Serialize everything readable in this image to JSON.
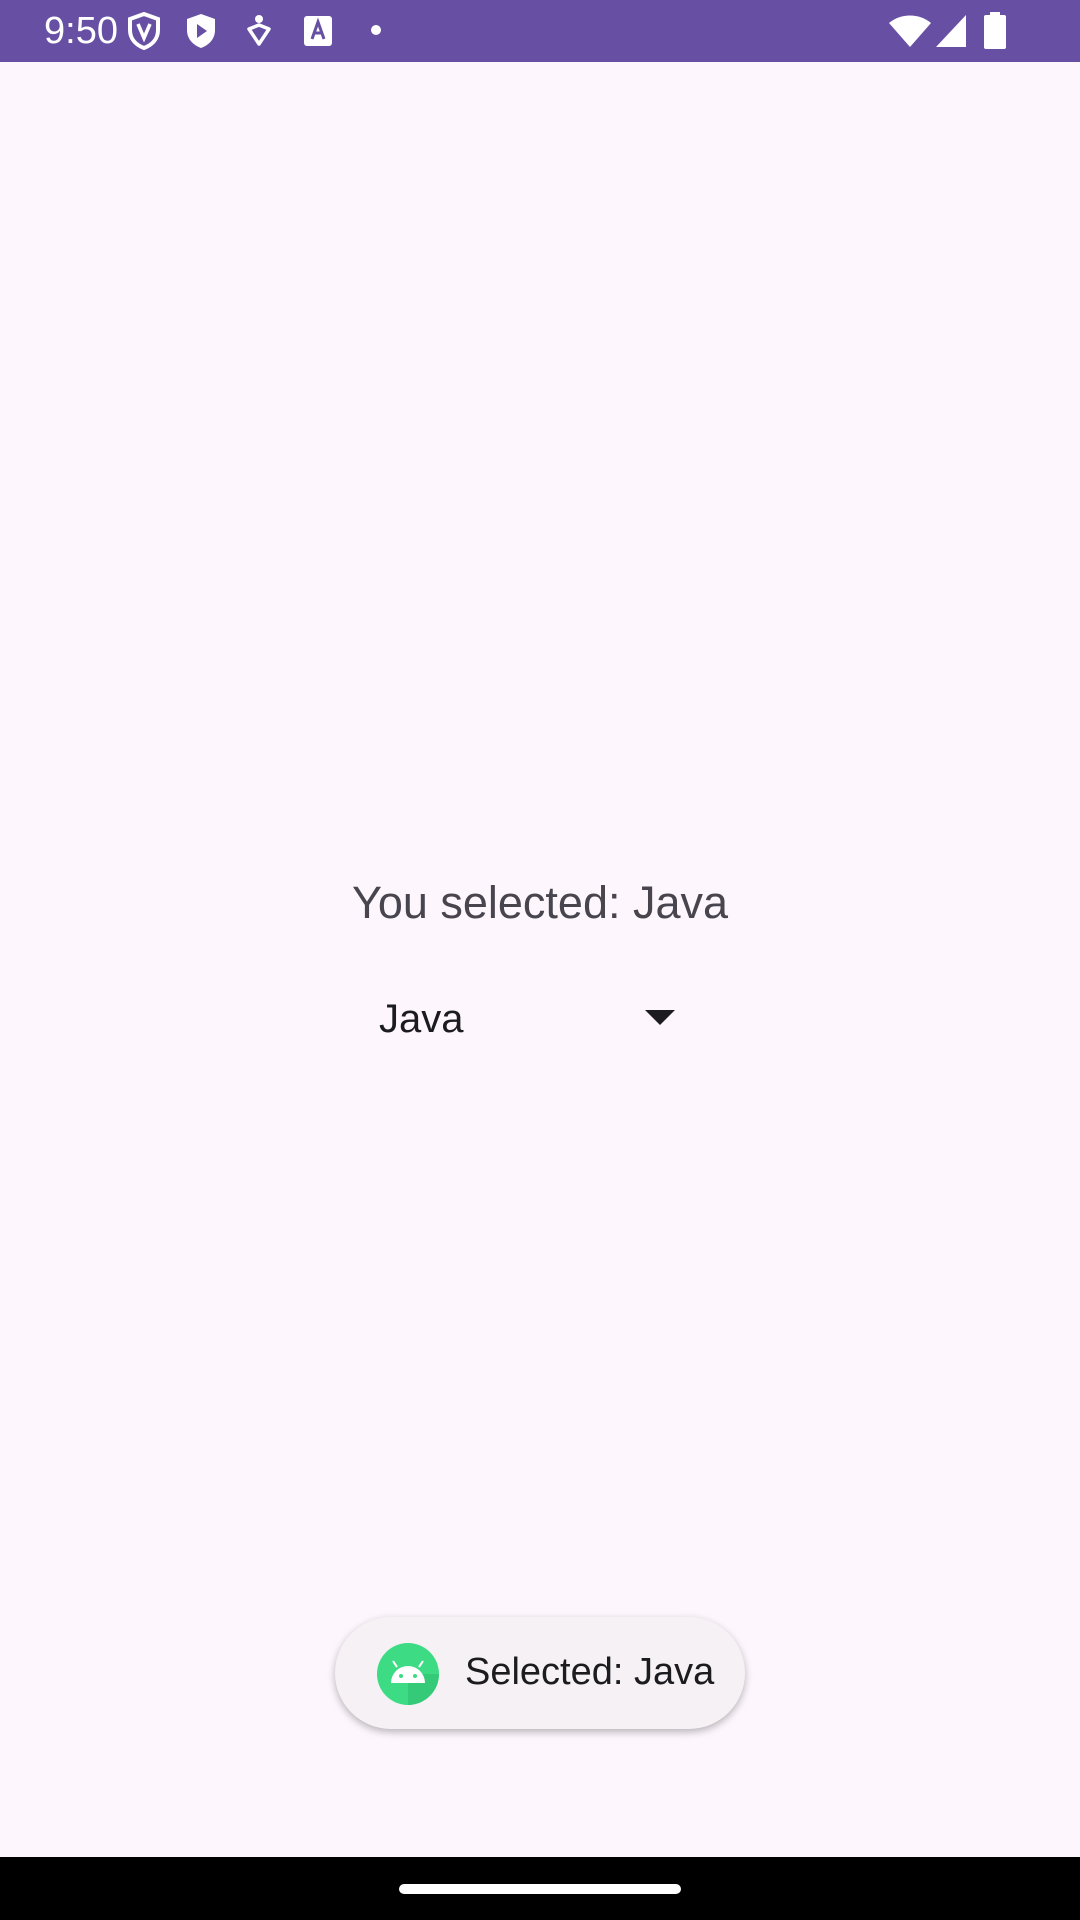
{
  "status_bar": {
    "time": "9:50",
    "background": "#6750A4",
    "icons_left": [
      "shield-outline-icon",
      "shield-play-icon",
      "accessibility-icon",
      "text-a-icon",
      "dot-icon"
    ],
    "icons_right": [
      "wifi-icon",
      "cellular-signal-icon",
      "battery-icon"
    ]
  },
  "main": {
    "selected_text": "You selected: Java",
    "spinner": {
      "selected_value": "Java",
      "dropdown_icon": "arrow-drop-down-icon"
    }
  },
  "toast": {
    "icon": "android-app-icon",
    "message": "Selected: Java"
  },
  "colors": {
    "background": "#FDF7FD",
    "accent": "#6750A4",
    "nav_bar": "#000000"
  }
}
